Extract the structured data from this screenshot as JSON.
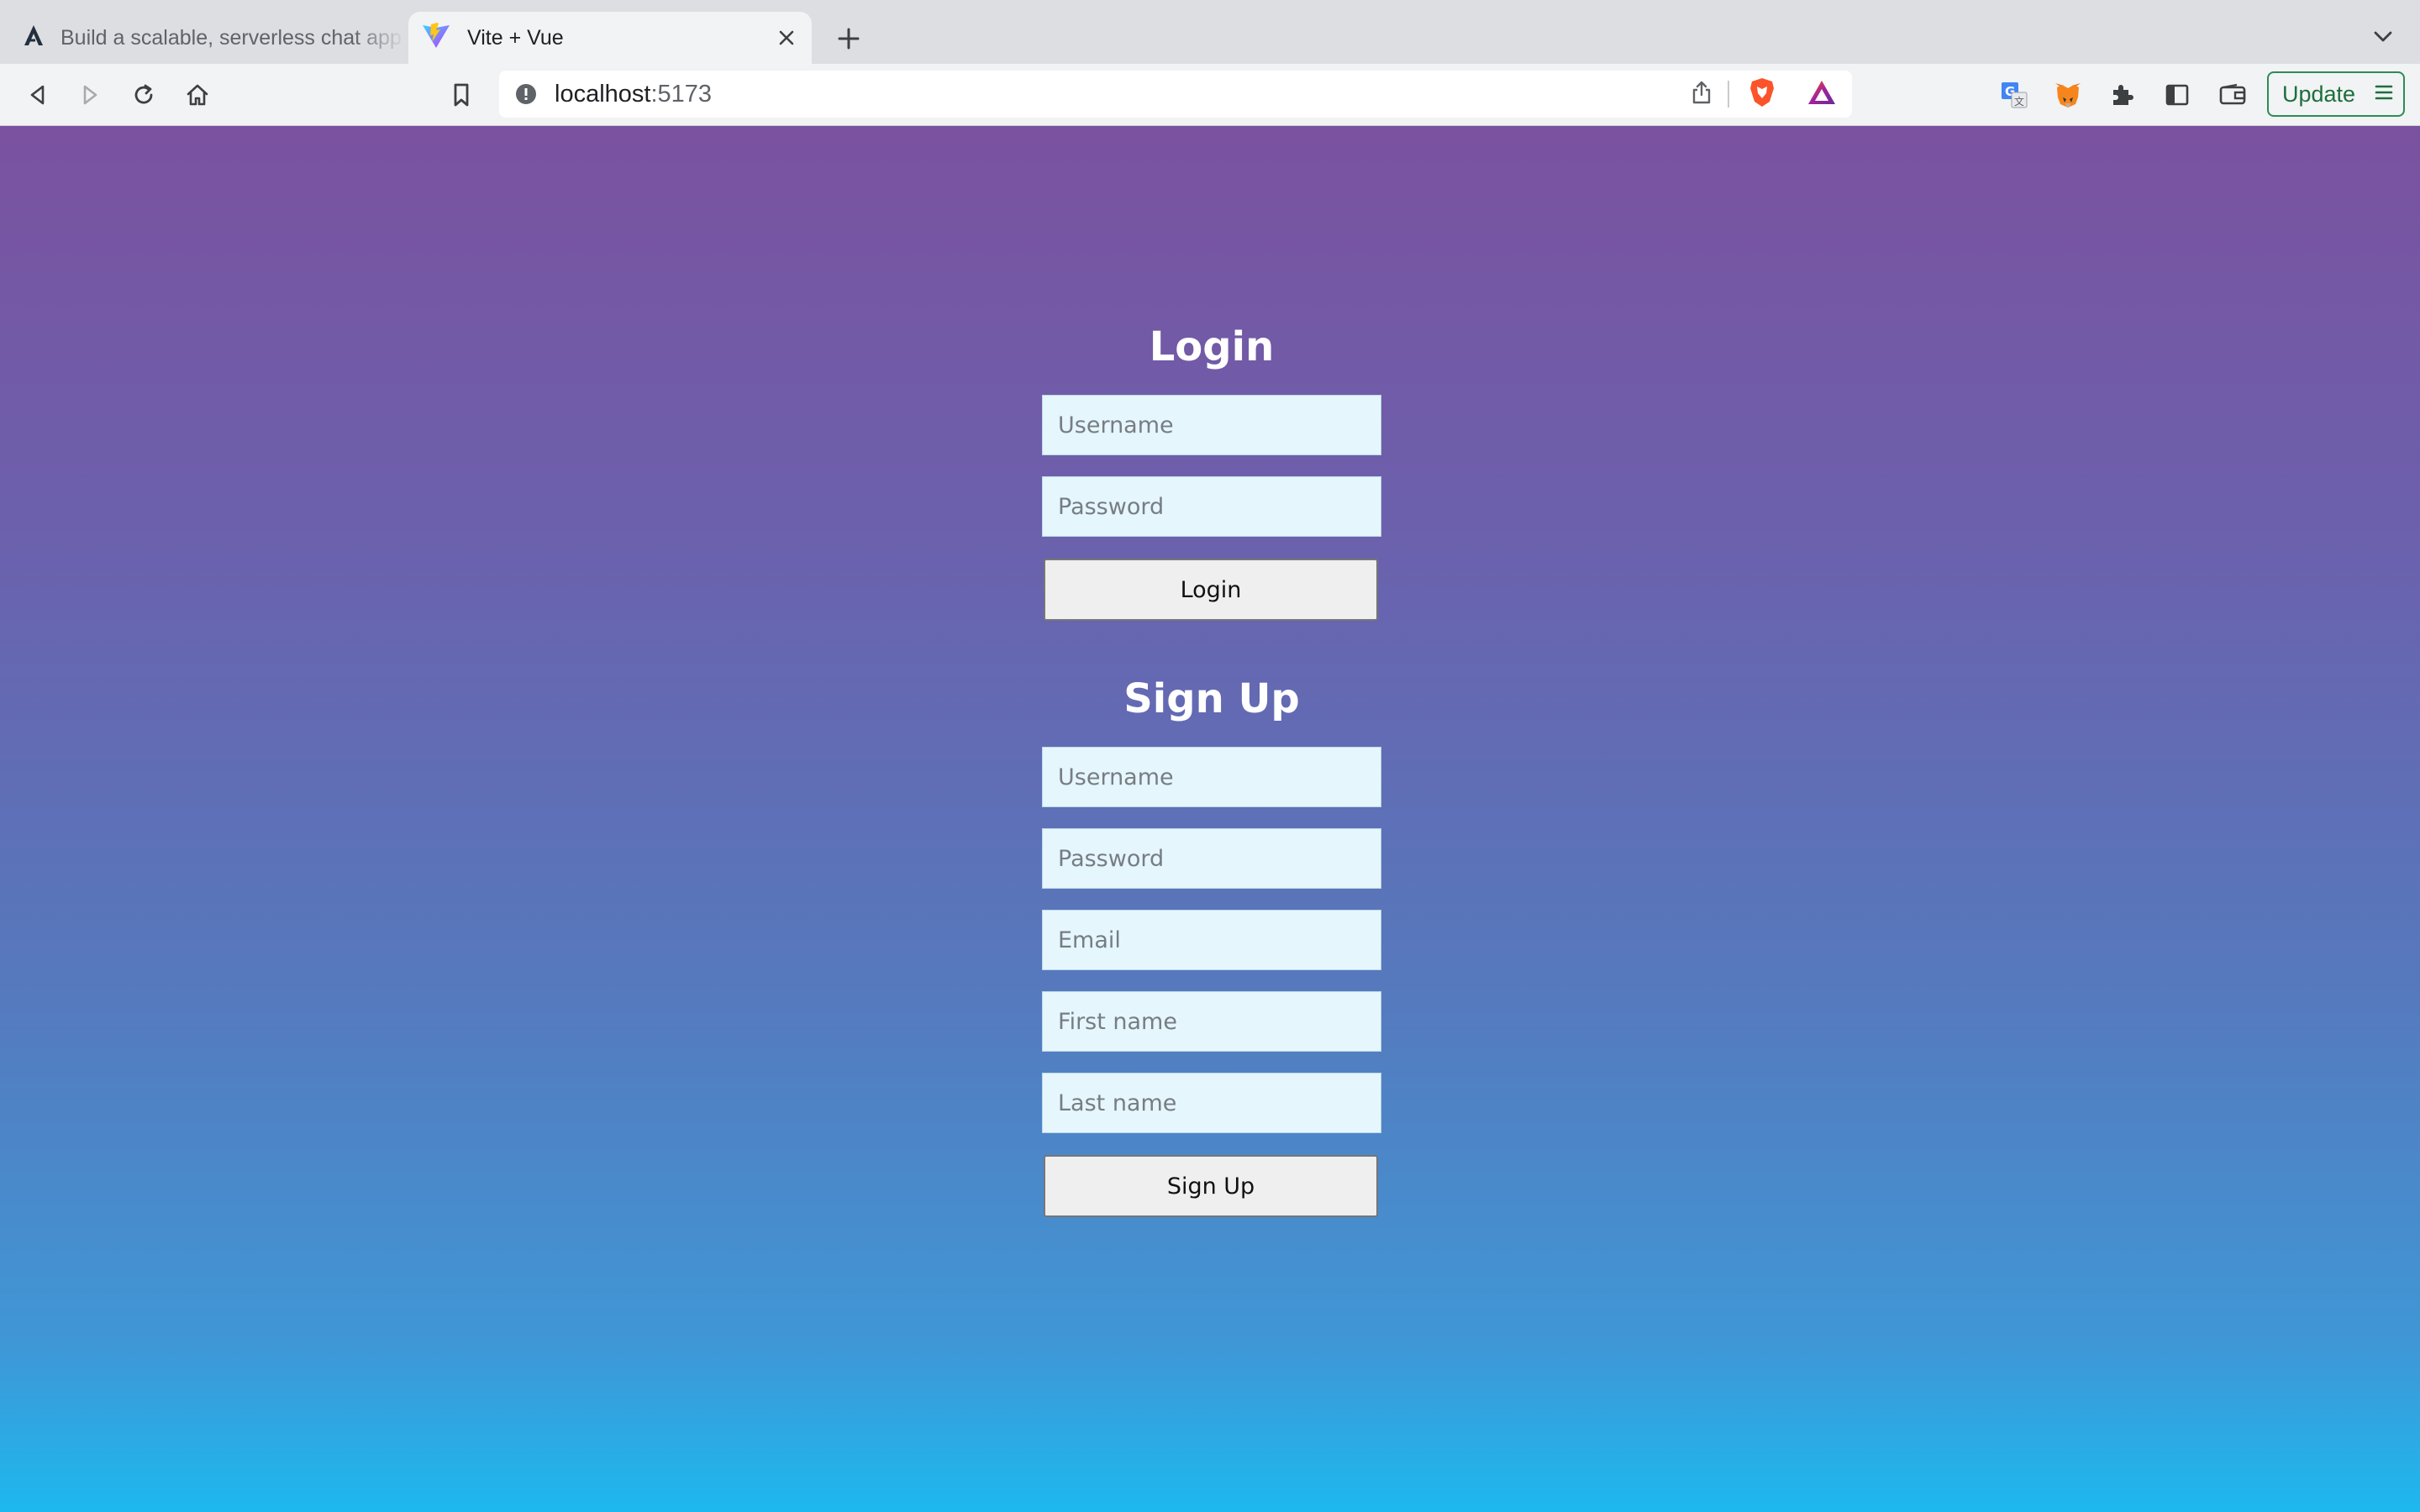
{
  "browser": {
    "tabs": [
      {
        "title": "Build a scalable, serverless chat app",
        "active": false,
        "icon": "amplify-logo-icon"
      },
      {
        "title": "Vite + Vue",
        "active": true,
        "icon": "vite-logo-icon"
      }
    ],
    "address": {
      "host": "localhost",
      "port": ":5173"
    },
    "update_label": "Update"
  },
  "login": {
    "title": "Login",
    "username_placeholder": "Username",
    "password_placeholder": "Password",
    "submit_label": "Login"
  },
  "signup": {
    "title": "Sign Up",
    "username_placeholder": "Username",
    "password_placeholder": "Password",
    "email_placeholder": "Email",
    "first_name_placeholder": "First name",
    "last_name_placeholder": "Last name",
    "submit_label": "Sign Up"
  },
  "colors": {
    "gradient_top": "#7a52a0",
    "gradient_bottom": "#1db8ef",
    "input_bg": "#e5f6fd",
    "update_border": "#2e8b57"
  }
}
